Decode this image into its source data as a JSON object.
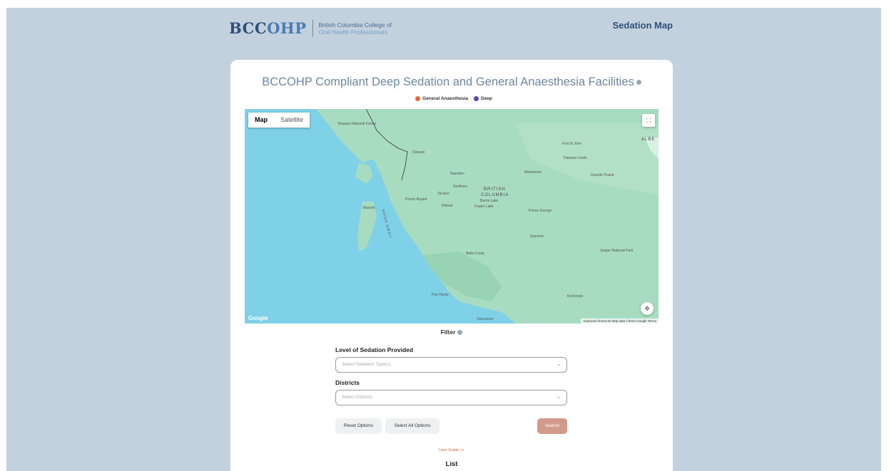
{
  "header": {
    "logo_a": "BCC",
    "logo_b": "OHP",
    "logo_sub_1": "British Columbia College of",
    "logo_sub_2": "Oral Health Professionals",
    "nav_title": "Sedation Map"
  },
  "page": {
    "title": "BCCOHP Compliant Deep Sedation and General Anaesthesia Facilities"
  },
  "legend": {
    "items": [
      {
        "label": "General Anaesthesia",
        "color": "#e8692c"
      },
      {
        "label": "Deep",
        "color": "#5b45a8"
      }
    ]
  },
  "map": {
    "type_map": "Map",
    "type_satellite": "Satellite",
    "google": "Google",
    "attribution": "Keyboard shortcuts   Map data ©2023 Google   Terms",
    "labels": {
      "bc": "BRITISH",
      "bc2": "COLUMBIA",
      "haida": "HAIDA GWAII",
      "prince_rupert": "Prince Rupert",
      "smithers": "Smithers",
      "prince_george": "Prince George",
      "quesnel": "Quesnel",
      "kamloops": "Kamloops",
      "vancouver": "Vancouver",
      "port_hardy": "Port Hardy",
      "bella_coola": "Bella Coola",
      "terrace": "Terrace",
      "stewart": "Stewart",
      "hazelton": "Hazelton",
      "fort_st_john": "Fort St John",
      "dawson_creek": "Dawson Creek",
      "grande_prairie": "Grande Prairie",
      "jasper": "Jasper National Park",
      "tongass": "Tongass National Forest",
      "masset": "Masset",
      "kitimat": "Kitimat",
      "burns_lake": "Burns Lake",
      "fraser_lake": "Fraser Lake",
      "mackenzie": "Mackenzie",
      "alberta": "ALBE"
    }
  },
  "filter": {
    "title": "Filter",
    "sedation_label": "Level of Sedation Provided",
    "sedation_placeholder": "Select Sedation Type(s)",
    "districts_label": "Districts",
    "districts_placeholder": "Select Districts",
    "reset_label": "Reset Options",
    "select_all_label": "Select All Options",
    "search_label": "Search"
  },
  "user_guide": "User Guide >>",
  "list_title": "List"
}
